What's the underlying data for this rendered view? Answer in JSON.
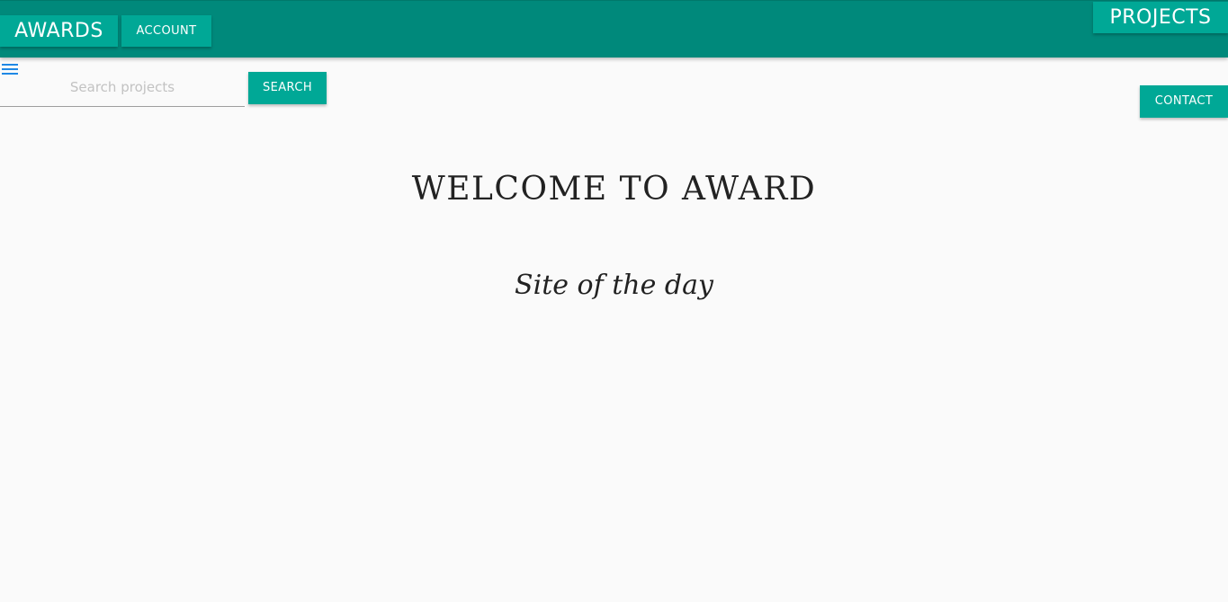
{
  "header": {
    "brand_label": "AWARDS",
    "account_label": "ACCOUNT",
    "projects_label": "PROJECTS"
  },
  "search": {
    "placeholder": "Search projects",
    "value": "",
    "button_label": "SEARCH"
  },
  "contact": {
    "button_label": "CONTACT"
  },
  "main": {
    "title": "WELCOME TO AWARD",
    "subtitle": "Site of the day"
  },
  "icons": {
    "menu": "menu-icon"
  },
  "colors": {
    "topbar": "#00897b",
    "button": "#00a896",
    "menu_icon": "#1e88e5",
    "background": "#fafafa"
  }
}
